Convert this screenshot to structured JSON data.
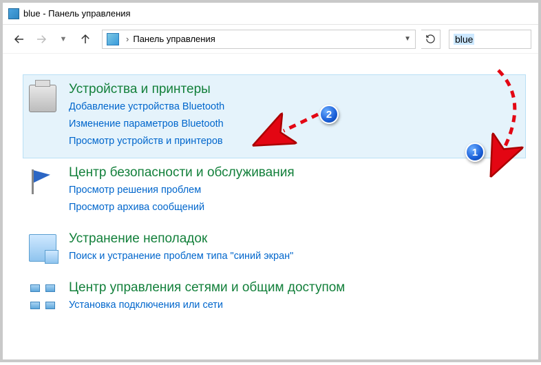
{
  "titlebar": {
    "text": "blue - Панель управления"
  },
  "navbar": {
    "breadcrumb": "Панель управления",
    "search_query": "blue"
  },
  "annotations": {
    "badge1": "1",
    "badge2": "2"
  },
  "results": [
    {
      "title": "Устройства и принтеры",
      "links": [
        "Добавление устройства Bluetooth",
        "Изменение параметров Bluetooth",
        "Просмотр устройств и принтеров"
      ]
    },
    {
      "title": "Центр безопасности и обслуживания",
      "links": [
        "Просмотр решения проблем",
        "Просмотр архива сообщений"
      ]
    },
    {
      "title": "Устранение неполадок",
      "links": [
        "Поиск и устранение проблем типа \"синий экран\""
      ]
    },
    {
      "title": "Центр управления сетями и общим доступом",
      "links": [
        "Установка подключения или сети"
      ]
    }
  ]
}
